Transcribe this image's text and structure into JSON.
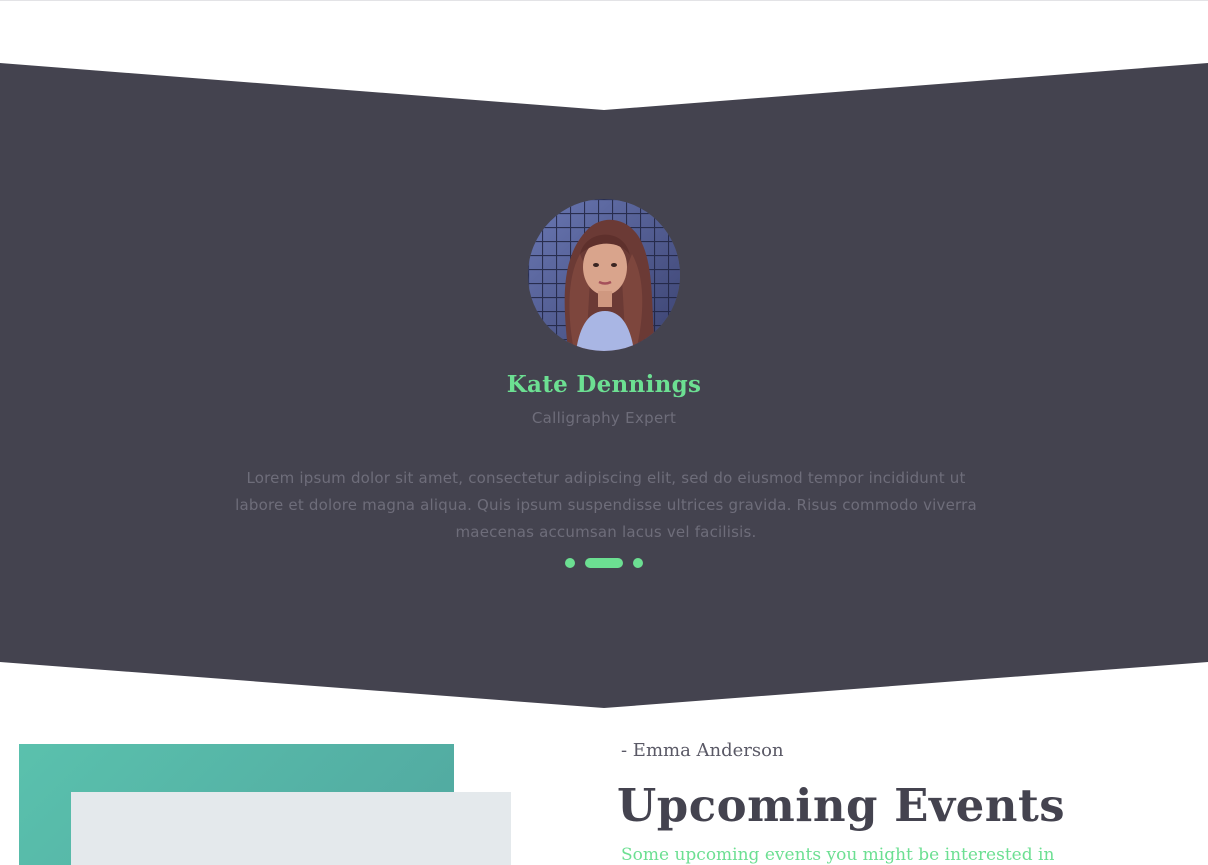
{
  "colors": {
    "band_background": "#44434f",
    "accent": "#6cdf92",
    "muted_text": "#6e6d7a",
    "heading_text": "#44434f",
    "teal": "#5ac1ad",
    "light_grey": "#e4e9ec"
  },
  "testimonial": {
    "avatar_alt": "avatar",
    "name": "Kate Dennings",
    "role": "Calligraphy Expert",
    "quote": "Lorem ipsum dolor sit amet, consectetur adipiscing elit, sed do eiusmod tempor incididunt ut labore et dolore magna aliqua. Quis ipsum suspendisse ultrices gravida. Risus commodo viverra maecenas accumsan lacus vel facilisis.",
    "carousel": {
      "slides": 3,
      "active_index": 1
    }
  },
  "events": {
    "author": "- Emma Anderson",
    "title": "Upcoming Events",
    "subtitle": "Some upcoming events you might be interested in"
  }
}
